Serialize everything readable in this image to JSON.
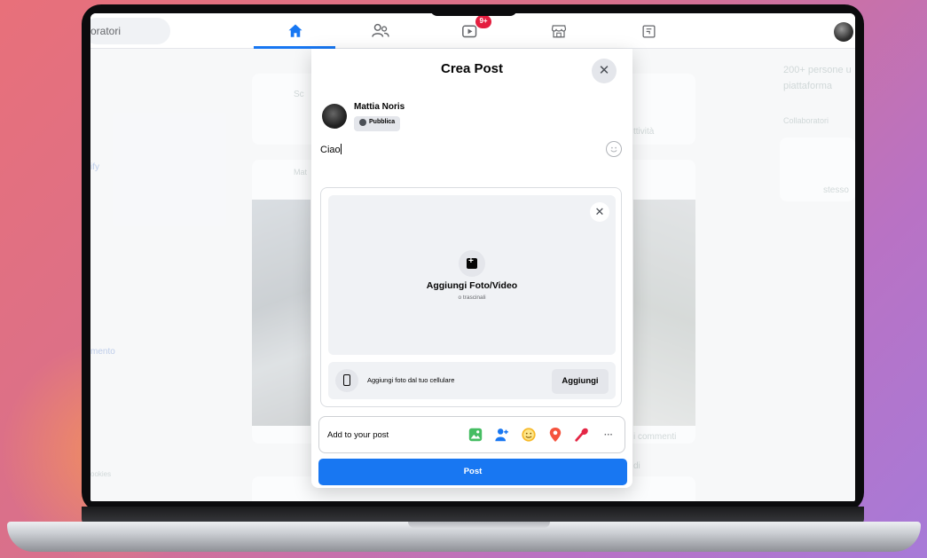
{
  "topbar": {
    "search_text": "oratori",
    "notification_badge": "9+"
  },
  "background": {
    "right_text_1": "200+ persone u",
    "right_text_2": "piattaforma",
    "right_text_3": "Collaboratori",
    "right_text_4": "stesso",
    "feed_text_1": "Sc",
    "feed_text_2": "ttività",
    "feed_text_3": "Mat",
    "feed_text_4": "i commenti",
    "feed_text_5": "di",
    "left_text_1": "ify",
    "left_text_2": "mento",
    "left_text_3": "ookies"
  },
  "dialog": {
    "title": "Crea Post",
    "close_symbol": "✕",
    "user_name": "Mattia Noris",
    "privacy_label": "Pubblica",
    "post_text": "Ciao",
    "media": {
      "close_symbol": "✕",
      "add_label": "Aggiungi Foto/Video",
      "drag_hint": "o trascinali",
      "mobile_text": "Aggiungi foto dal tuo cellulare",
      "mobile_button": "Aggiungi"
    },
    "add_to_post_label": "Add to your post",
    "add_icons": [
      "photo-icon",
      "tag-people-icon",
      "feeling-icon",
      "location-icon",
      "live-video-icon",
      "more-icon"
    ],
    "more_symbol": "···",
    "post_button": "Post"
  },
  "colors": {
    "accent": "#1877f2",
    "badge": "#e41e3f",
    "photo_icon": "#45bd62",
    "tag_icon": "#1877f2",
    "feeling_icon": "#f7b928",
    "location_icon": "#f5533d",
    "live_icon": "#e42645"
  }
}
